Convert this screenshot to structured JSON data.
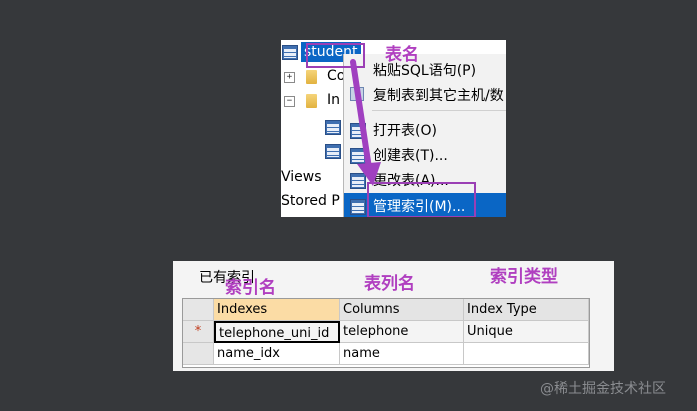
{
  "top_screenshot": {
    "tree": {
      "selected_table": "student",
      "folder_1_label": "Co",
      "folder_2_label": "In",
      "views_label": "Views",
      "stored_label": "Stored P"
    },
    "context_menu": {
      "items": [
        {
          "label": "粘贴SQL语句(P)"
        },
        {
          "label": "复制表到其它主机/数"
        },
        {
          "label": "打开表(O)"
        },
        {
          "label": "创建表(T)..."
        },
        {
          "label": "更改表(A)..."
        },
        {
          "label": "管理索引(M)..."
        }
      ]
    },
    "annotation_table_name": "表名"
  },
  "bottom_screenshot": {
    "caption": "已有索引",
    "annotations": {
      "index_name": "索引名",
      "column_name": "表列名",
      "index_type": "索引类型"
    },
    "grid": {
      "columns": [
        "Indexes",
        "Columns",
        "Index Type"
      ],
      "row_marker": "*",
      "rows": [
        [
          "telephone_uni_id",
          "telephone",
          "Unique"
        ],
        [
          "name_idx",
          "name",
          ""
        ]
      ]
    }
  },
  "watermark": "@稀土掘金技术社区",
  "colors": {
    "background": "#36383b",
    "annotation": "#b03fc0",
    "menu_highlight": "#0a66c5",
    "header_selected": "#fbdca5"
  }
}
